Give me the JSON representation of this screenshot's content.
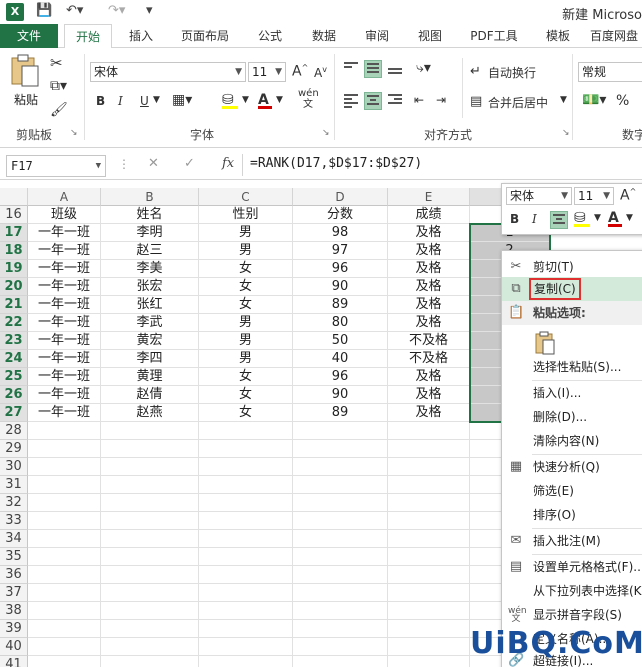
{
  "titlebar": {
    "logo": "X",
    "title": "新建 Microso"
  },
  "ribbon_tabs": [
    {
      "label": "文件"
    },
    {
      "label": "开始"
    },
    {
      "label": "插入"
    },
    {
      "label": "页面布局"
    },
    {
      "label": "公式"
    },
    {
      "label": "数据"
    },
    {
      "label": "审阅"
    },
    {
      "label": "视图"
    },
    {
      "label": "PDF工具"
    },
    {
      "label": "模板"
    },
    {
      "label": "百度网盘"
    }
  ],
  "ribbon": {
    "paste_label": "粘贴",
    "clipboard_group": "剪贴板",
    "font_name": "宋体",
    "font_size": "11",
    "font_group": "字体",
    "bold": "B",
    "italic": "I",
    "underline": "U",
    "grow_font": "A",
    "shrink_font": "A",
    "fill_color": "#ffff00",
    "font_color": "#d40000",
    "wen": "wén 文",
    "wrap_text": "自动换行",
    "merge_center": "合并后居中",
    "align_group": "对齐方式",
    "number_format": "常规",
    "number_group": "数字",
    "percent": "%"
  },
  "formula_bar": {
    "name_box": "F17",
    "cancel": "✕",
    "enter": "✓",
    "fx": "fx",
    "formula": "=RANK(D17,$D$17:$D$27)"
  },
  "sheet": {
    "columns": [
      "A",
      "B",
      "C",
      "D",
      "E",
      "F"
    ],
    "header_row": {
      "row": "16",
      "cells": [
        "班级",
        "姓名",
        "性别",
        "分数",
        "成绩",
        "名"
      ]
    },
    "data_rows": [
      {
        "row": "17",
        "cells": [
          "一年一班",
          "李明",
          "男",
          "98",
          "及格",
          "1"
        ]
      },
      {
        "row": "18",
        "cells": [
          "一年一班",
          "赵三",
          "男",
          "97",
          "及格",
          "2"
        ]
      },
      {
        "row": "19",
        "cells": [
          "一年一班",
          "李美",
          "女",
          "96",
          "及格",
          ""
        ]
      },
      {
        "row": "20",
        "cells": [
          "一年一班",
          "张宏",
          "女",
          "90",
          "及格",
          ""
        ]
      },
      {
        "row": "21",
        "cells": [
          "一年一班",
          "张红",
          "女",
          "89",
          "及格",
          ""
        ]
      },
      {
        "row": "22",
        "cells": [
          "一年一班",
          "李武",
          "男",
          "80",
          "及格",
          ""
        ]
      },
      {
        "row": "23",
        "cells": [
          "一年一班",
          "黄宏",
          "男",
          "50",
          "不及格",
          ""
        ]
      },
      {
        "row": "24",
        "cells": [
          "一年一班",
          "李四",
          "男",
          "40",
          "不及格",
          ""
        ]
      },
      {
        "row": "25",
        "cells": [
          "一年一班",
          "黄理",
          "女",
          "96",
          "及格",
          ""
        ]
      },
      {
        "row": "26",
        "cells": [
          "一年一班",
          "赵倩",
          "女",
          "90",
          "及格",
          ""
        ]
      },
      {
        "row": "27",
        "cells": [
          "一年一班",
          "赵燕",
          "女",
          "89",
          "及格",
          ""
        ]
      }
    ],
    "empty_rows": [
      "28",
      "29",
      "30",
      "31",
      "32",
      "33",
      "34",
      "35",
      "36",
      "37",
      "38",
      "39",
      "40",
      "41"
    ]
  },
  "mini_toolbar": {
    "font_name": "宋体",
    "font_size": "11",
    "bold": "B",
    "italic": "I",
    "grow": "A"
  },
  "context_menu": {
    "cut": "剪切(T)",
    "copy": "复制(C)",
    "paste_options": "粘贴选项:",
    "paste_special": "选择性粘贴(S)...",
    "insert": "插入(I)...",
    "delete": "删除(D)...",
    "clear": "清除内容(N)",
    "quick_analysis": "快速分析(Q)",
    "filter": "筛选(E)",
    "sort": "排序(O)",
    "insert_comment": "插入批注(M)",
    "format_cells": "设置单元格格式(F)...",
    "pick_list": "从下拉列表中选择(K)...",
    "phonetic": "显示拼音字段(S)",
    "define_name": "定义名称(A)...",
    "hyperlink": "超链接(I)..."
  },
  "watermark": "UiBQ.CoM"
}
